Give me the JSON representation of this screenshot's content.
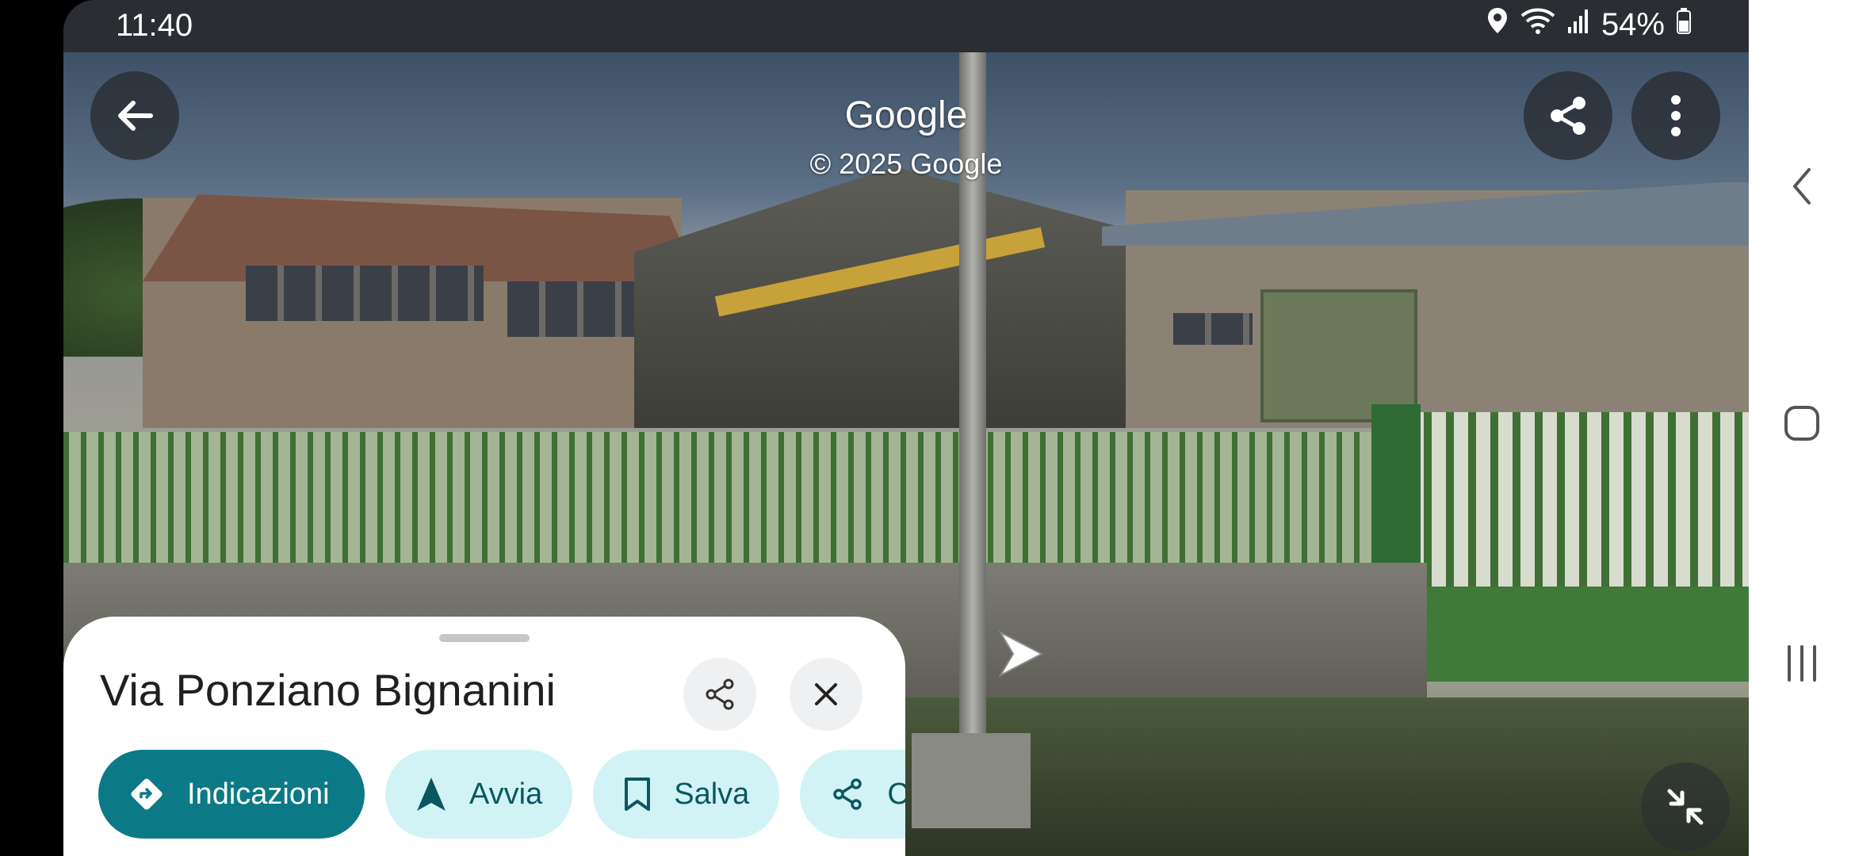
{
  "status_bar": {
    "time": "11:40",
    "battery": "54%",
    "icons": [
      "location-icon",
      "wifi-icon",
      "signal-icon",
      "battery-icon"
    ]
  },
  "viewer": {
    "brand": "Google",
    "copyright": "© 2025 Google"
  },
  "top_controls": [
    "back-icon",
    "share-icon",
    "more-vert-icon"
  ],
  "place": {
    "title": "Via Ponziano Bignanini"
  },
  "actions": [
    {
      "label": "Indicazioni",
      "icon": "directions-icon",
      "style": "primary"
    },
    {
      "label": "Avvia",
      "icon": "navigation-icon",
      "style": "secondary"
    },
    {
      "label": "Salva",
      "icon": "bookmark-icon",
      "style": "secondary"
    },
    {
      "label": "Condividi",
      "icon": "share-icon",
      "style": "secondary"
    }
  ],
  "nav_bar": [
    "back-icon",
    "home-icon",
    "recents-icon"
  ],
  "colors": {
    "primary": "#0b7a86",
    "secondary_chip": "#d2f3f6"
  }
}
